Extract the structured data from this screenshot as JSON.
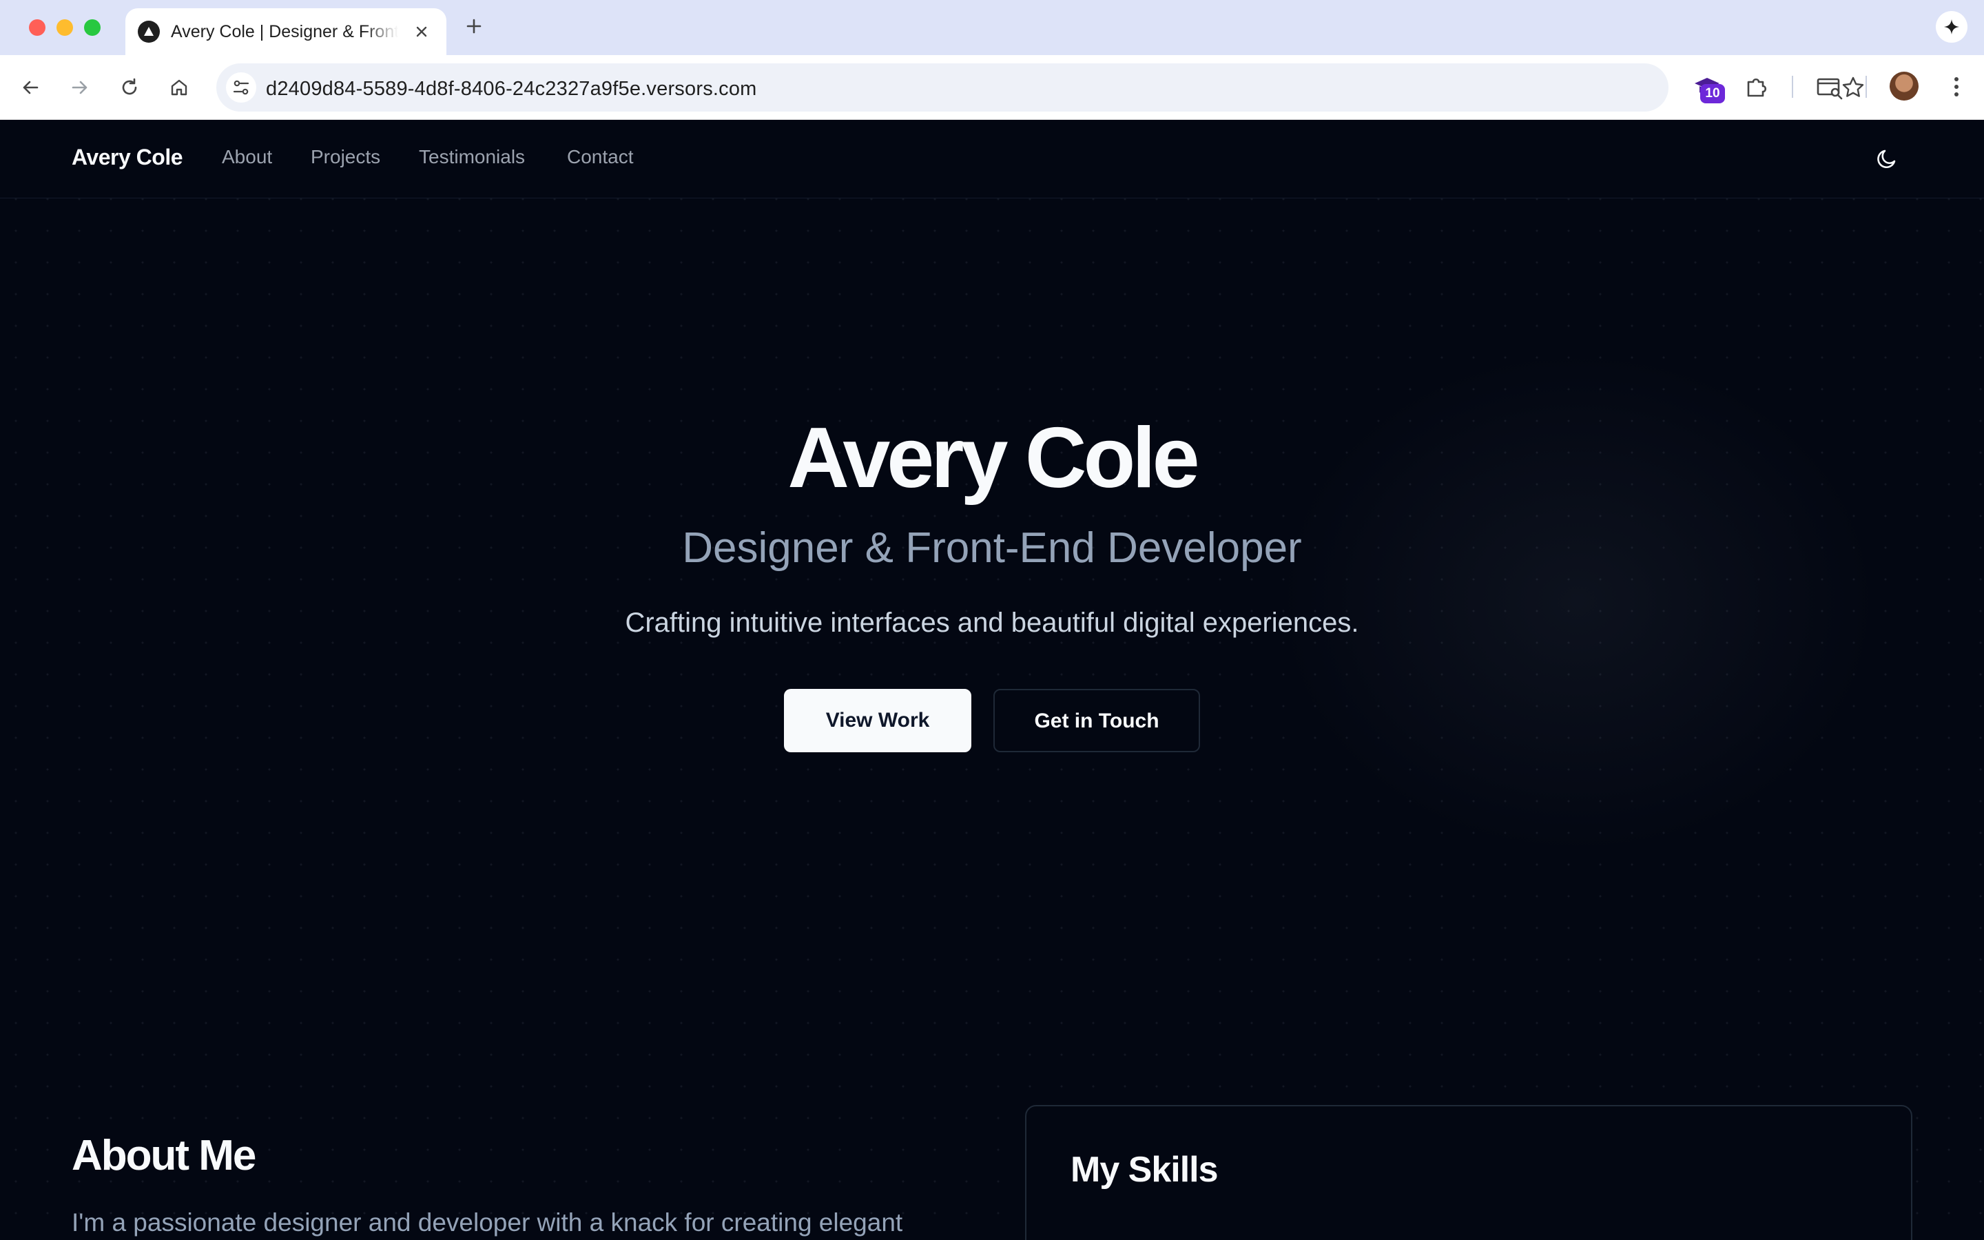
{
  "browser": {
    "tab_title": "Avery Cole | Designer & Front-End Developer",
    "url": "d2409d84-5589-4d8f-8406-24c2327a9f5e.versors.com",
    "extension_badge": "10"
  },
  "site": {
    "brand": "Avery Cole",
    "nav": [
      "About",
      "Projects",
      "Testimonials",
      "Contact"
    ]
  },
  "hero": {
    "title": "Avery Cole",
    "subtitle": "Designer & Front-End Developer",
    "tagline": "Crafting intuitive interfaces and beautiful digital experiences.",
    "primary_button": "View Work",
    "secondary_button": "Get in Touch"
  },
  "about": {
    "title": "About Me",
    "text": "I'm a passionate designer and developer with a knack for creating elegant"
  },
  "skills": {
    "title": "My Skills"
  },
  "colors": {
    "background": "#030712",
    "primary_text": "#f8fafc",
    "muted_text": "#94a3b8",
    "border": "#1f2937"
  }
}
